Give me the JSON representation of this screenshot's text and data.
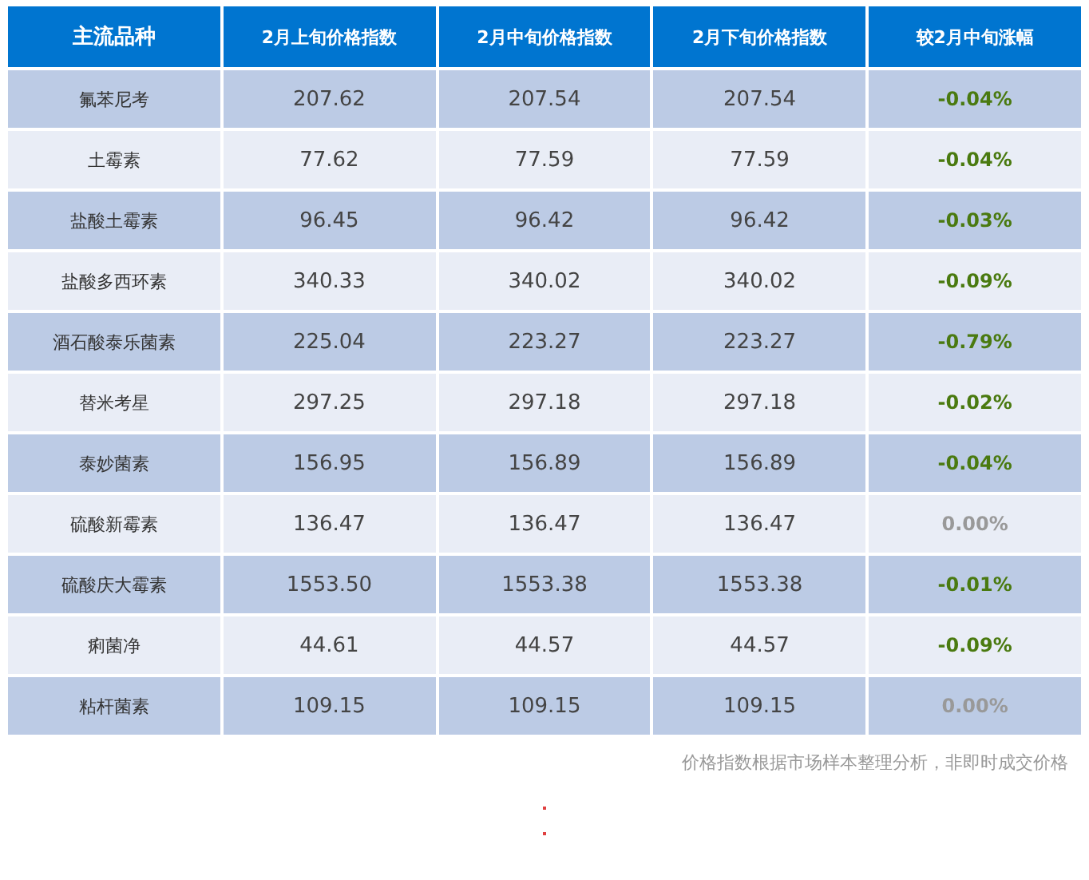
{
  "table": {
    "columns": [
      "主流品种",
      "2月上旬价格指数",
      "2月中旬价格指数",
      "2月下旬价格指数",
      "较2月中旬涨幅"
    ],
    "rows": [
      {
        "name": "氟苯尼考",
        "values": [
          "207.62",
          "207.54",
          "207.54"
        ],
        "change": "-0.04%",
        "color": "#4a7a10"
      },
      {
        "name": "土霉素",
        "values": [
          "77.62",
          "77.59",
          "77.59"
        ],
        "change": "-0.04%",
        "color": "#4a7a10"
      },
      {
        "name": "盐酸土霉素",
        "values": [
          "96.45",
          "96.42",
          "96.42"
        ],
        "change": "-0.03%",
        "color": "#4a7a10"
      },
      {
        "name": "盐酸多西环素",
        "values": [
          "340.33",
          "340.02",
          "340.02"
        ],
        "change": "-0.09%",
        "color": "#4a7a10"
      },
      {
        "name": "酒石酸泰乐菌素",
        "values": [
          "225.04",
          "223.27",
          "223.27"
        ],
        "change": "-0.79%",
        "color": "#4a7a10"
      },
      {
        "name": "替米考星",
        "values": [
          "297.25",
          "297.18",
          "297.18"
        ],
        "change": "-0.02%",
        "color": "#4a7a10"
      },
      {
        "name": "泰妙菌素",
        "values": [
          "156.95",
          "156.89",
          "156.89"
        ],
        "change": "-0.04%",
        "color": "#4a7a10"
      },
      {
        "name": "硫酸新霉素",
        "values": [
          "136.47",
          "136.47",
          "136.47"
        ],
        "change": "0.00%",
        "color": "#999999"
      },
      {
        "name": "硫酸庆大霉素",
        "values": [
          "1553.50",
          "1553.38",
          "1553.38"
        ],
        "change": "-0.01%",
        "color": "#4a7a10"
      },
      {
        "name": "痢菌净",
        "values": [
          "44.61",
          "44.57",
          "44.57"
        ],
        "change": "-0.09%",
        "color": "#4a7a10"
      },
      {
        "name": "粘杆菌素",
        "values": [
          "109.15",
          "109.15",
          "109.15"
        ],
        "change": "0.00%",
        "color": "#999999"
      }
    ]
  },
  "note": "价格指数根据市场样本整理分析，非即时成交价格"
}
